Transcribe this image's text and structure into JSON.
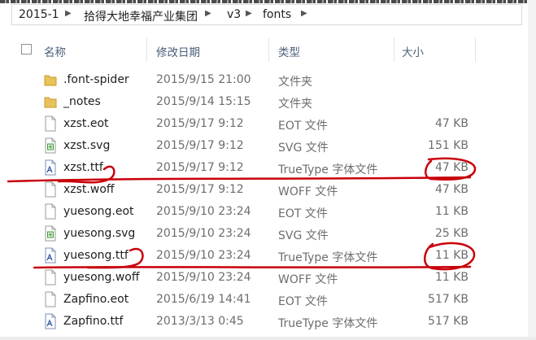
{
  "breadcrumb": {
    "items": [
      "2015-1",
      "拾得大地幸福产业集团",
      "v3",
      "fonts"
    ]
  },
  "header": {
    "name": "名称",
    "date": "修改日期",
    "type": "类型",
    "size": "大小"
  },
  "files": [
    {
      "name": ".font-spider",
      "date": "2015/9/15 21:00",
      "type": "文件夹",
      "size": "",
      "icon": "folder-icon"
    },
    {
      "name": "_notes",
      "date": "2015/9/14 15:15",
      "type": "文件夹",
      "size": "",
      "icon": "folder-icon"
    },
    {
      "name": "xzst.eot",
      "date": "2015/9/17 9:12",
      "type": "EOT 文件",
      "size": "47 KB",
      "icon": "file-icon"
    },
    {
      "name": "xzst.svg",
      "date": "2015/9/17 9:12",
      "type": "SVG 文件",
      "size": "151 KB",
      "icon": "svg-file-icon"
    },
    {
      "name": "xzst.ttf",
      "date": "2015/9/17 9:12",
      "type": "TrueType 字体文件",
      "size": "47 KB",
      "icon": "font-file-icon"
    },
    {
      "name": "xzst.woff",
      "date": "2015/9/17 9:12",
      "type": "WOFF 文件",
      "size": "47 KB",
      "icon": "file-icon"
    },
    {
      "name": "yuesong.eot",
      "date": "2015/9/10 23:24",
      "type": "EOT 文件",
      "size": "11 KB",
      "icon": "file-icon"
    },
    {
      "name": "yuesong.svg",
      "date": "2015/9/10 23:24",
      "type": "SVG 文件",
      "size": "25 KB",
      "icon": "svg-file-icon"
    },
    {
      "name": "yuesong.ttf",
      "date": "2015/9/10 23:24",
      "type": "TrueType 字体文件",
      "size": "11 KB",
      "icon": "font-file-icon"
    },
    {
      "name": "yuesong.woff",
      "date": "2015/9/10 23:24",
      "type": "WOFF 文件",
      "size": "11 KB",
      "icon": "file-icon"
    },
    {
      "name": "Zapfino.eot",
      "date": "2015/6/19 14:41",
      "type": "EOT 文件",
      "size": "517 KB",
      "icon": "file-icon"
    },
    {
      "name": "Zapfino.ttf",
      "date": "2013/3/13 0:45",
      "type": "TrueType 字体文件",
      "size": "517 KB",
      "icon": "font-file-icon"
    }
  ],
  "colors": {
    "annotation": "#c8000a",
    "folder": "#e8c25a",
    "header_text": "#4c607a"
  }
}
